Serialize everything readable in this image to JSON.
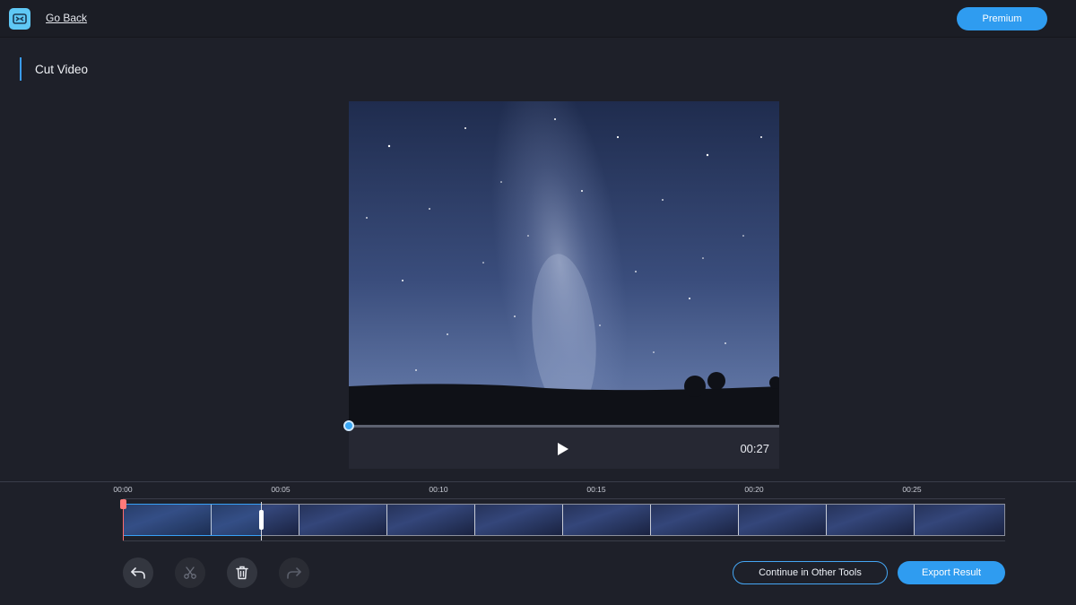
{
  "header": {
    "go_back_label": "Go Back",
    "premium_label": "Premium"
  },
  "page": {
    "title": "Cut Video"
  },
  "player": {
    "current_time": "00:27",
    "progress": 0.0
  },
  "timeline": {
    "ticks": [
      "00:00",
      "00:05",
      "00:10",
      "00:15",
      "00:20",
      "00:25"
    ],
    "thumbnail_count": 10,
    "selection_start": "00:00",
    "selection_end": "00:05"
  },
  "actions": {
    "continue_label": "Continue in Other Tools",
    "export_label": "Export Result"
  },
  "tools": [
    "undo-icon",
    "scissors-icon",
    "trash-icon",
    "redo-icon"
  ],
  "colors": {
    "accent": "#2f9cf0",
    "background": "#1e2029",
    "playhead": "#ff6b6b"
  }
}
